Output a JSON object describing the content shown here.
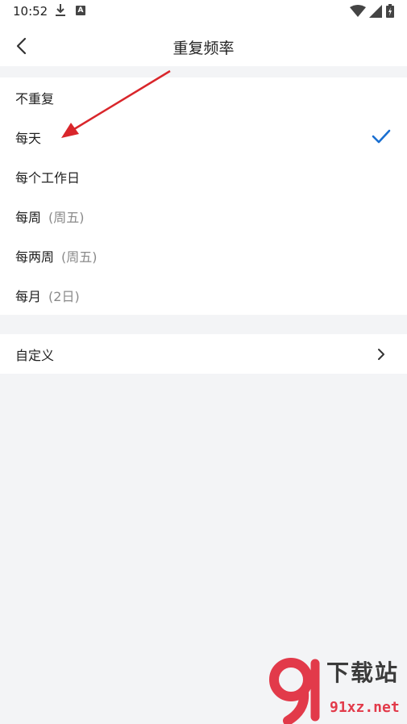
{
  "status_bar": {
    "time": "10:52",
    "a_badge": "A"
  },
  "header": {
    "title": "重复频率"
  },
  "options": [
    {
      "label": "不重复",
      "note": ""
    },
    {
      "label": "每天",
      "note": ""
    },
    {
      "label": "每个工作日",
      "note": ""
    },
    {
      "label": "每周",
      "note": "(周五)"
    },
    {
      "label": "每两周",
      "note": "(周五)"
    },
    {
      "label": "每月",
      "note": "(2日)"
    }
  ],
  "selected_option": "每天",
  "custom": {
    "label": "自定义"
  },
  "colors": {
    "accent": "#1a6fd1",
    "annotation_arrow": "#d9262b",
    "background": "#f3f4f6"
  },
  "watermark": {
    "brand_text": "下载站",
    "url": "91xz.net"
  }
}
